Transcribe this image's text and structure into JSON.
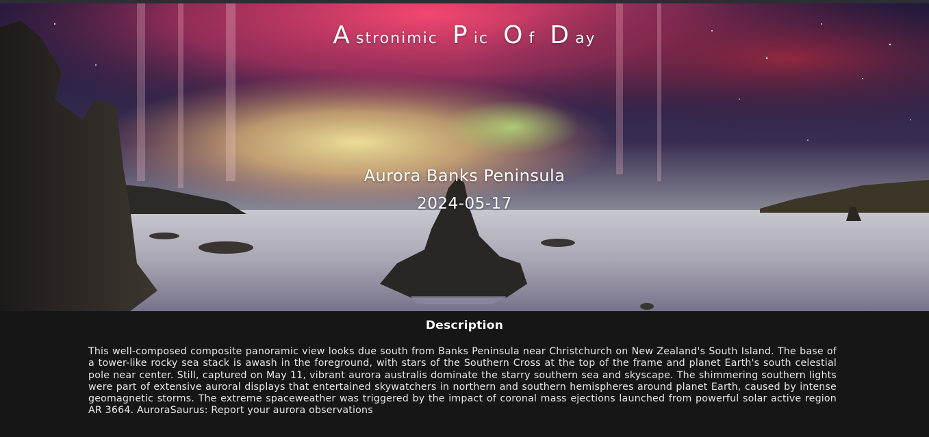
{
  "site": {
    "title_parts": [
      {
        "big": "A",
        "small": "stronimic"
      },
      {
        "big": "P",
        "small": "ic"
      },
      {
        "big": "O",
        "small": "f"
      },
      {
        "big": "D",
        "small": "ay"
      }
    ]
  },
  "picture": {
    "title": "Aurora Banks Peninsula",
    "date": "2024-05-17"
  },
  "description": {
    "heading": "Description",
    "text": "This well-composed composite panoramic view looks due south from Banks Peninsula near Christchurch on New Zealand's South Island. The base of a tower-like rocky sea stack is awash in the foreground, with stars of the Southern Cross at the top of the frame and planet Earth's south celestial pole near center. Still, captured on May 11, vibrant aurora australis dominate the starry southern sea and skyscape. The shimmering southern lights were part of extensive auroral displays that entertained skywatchers in northern and southern hemispheres around planet Earth, caused by intense geomagnetic storms. The extreme spaceweather was triggered by the impact of coronal mass ejections launched from powerful solar active region AR 3664. AuroraSaurus: Report your aurora observations"
  },
  "colors": {
    "page_background": "#161616",
    "top_bar": "#2b2e33",
    "aurora_red": "#e0406a",
    "aurora_yellow": "#f2d27a",
    "aurora_green": "#9fd36a",
    "sky_dark": "#141633",
    "text": "#ffffff"
  }
}
